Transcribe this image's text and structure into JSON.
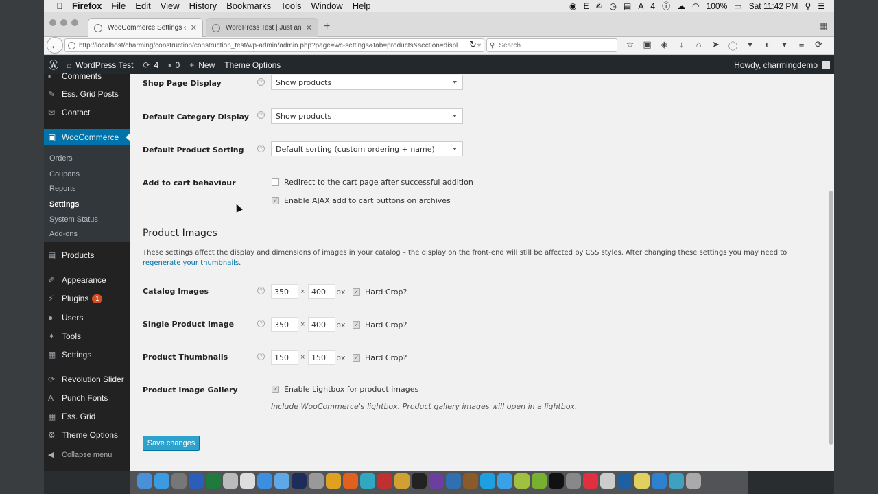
{
  "mac_menu": {
    "app_name": "Firefox",
    "items": [
      "File",
      "Edit",
      "View",
      "History",
      "Bookmarks",
      "Tools",
      "Window",
      "Help"
    ],
    "status": {
      "battery": "100%",
      "time": "Sat 11:42 PM",
      "badge_count": "4"
    }
  },
  "browser": {
    "tabs": [
      {
        "title": "WooCommerce Settings ‹ ..."
      },
      {
        "title": "WordPress Test | Just anot..."
      }
    ],
    "url": "http://localhost/charming/construction/construction_test/wp-admin/admin.php?page=wc-settings&tab=products&section=displ",
    "search_placeholder": "Search"
  },
  "adminbar": {
    "site_name": "WordPress Test",
    "updates_count": "4",
    "comments_count": "0",
    "new_label": "New",
    "theme_options_label": "Theme Options",
    "howdy": "Howdy, charmingdemo"
  },
  "sidebar": {
    "comments": "Comments",
    "ess_grid_posts": "Ess. Grid Posts",
    "contact": "Contact",
    "woocommerce": "WooCommerce",
    "submenu": [
      "Orders",
      "Coupons",
      "Reports",
      "Settings",
      "System Status",
      "Add-ons"
    ],
    "products": "Products",
    "appearance": "Appearance",
    "plugins": "Plugins",
    "plugins_badge": "1",
    "users": "Users",
    "tools": "Tools",
    "settings": "Settings",
    "revolution_slider": "Revolution Slider",
    "punch_fonts": "Punch Fonts",
    "ess_grid": "Ess. Grid",
    "theme_options": "Theme Options",
    "collapse": "Collapse menu"
  },
  "settings": {
    "shop_page_display": {
      "label": "Shop Page Display",
      "value": "Show products"
    },
    "default_category_display": {
      "label": "Default Category Display",
      "value": "Show products"
    },
    "default_product_sorting": {
      "label": "Default Product Sorting",
      "value": "Default sorting (custom ordering + name)"
    },
    "add_to_cart": {
      "label": "Add to cart behaviour",
      "redirect": {
        "label": "Redirect to the cart page after successful addition",
        "checked": false
      },
      "ajax": {
        "label": "Enable AJAX add to cart buttons on archives",
        "checked": true
      }
    },
    "product_images_title": "Product Images",
    "product_images_desc": "These settings affect the display and dimensions of images in your catalog – the display on the front-end will still be affected by CSS styles. After changing these settings you may need to",
    "regenerate_link": "regenerate your thumbnails",
    "catalog_images": {
      "label": "Catalog Images",
      "width": "350",
      "height": "400",
      "unit": "px",
      "hard_crop": "Hard Crop?"
    },
    "single_product_image": {
      "label": "Single Product Image",
      "width": "350",
      "height": "400",
      "unit": "px",
      "hard_crop": "Hard Crop?"
    },
    "product_thumbnails": {
      "label": "Product Thumbnails",
      "width": "150",
      "height": "150",
      "unit": "px",
      "hard_crop": "Hard Crop?"
    },
    "product_image_gallery": {
      "label": "Product Image Gallery",
      "lightbox_label": "Enable Lightbox for product images",
      "note": "Include WooCommerce's lightbox. Product gallery images will open in a lightbox."
    },
    "times": "×",
    "save_label": "Save changes"
  }
}
